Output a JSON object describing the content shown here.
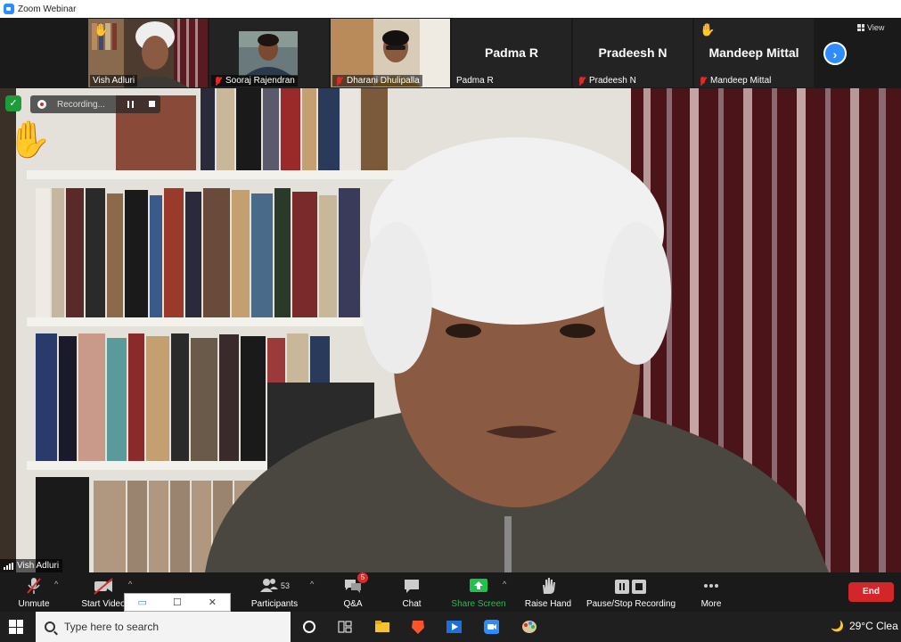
{
  "window": {
    "title": "Zoom Webinar"
  },
  "gallery": {
    "tiles": [
      {
        "name": "Vish Adluri"
      },
      {
        "name": "Sooraj Rajendran"
      },
      {
        "name": "Dharani Dhulipalla"
      },
      {
        "name": "Padma R",
        "display": "Padma R"
      },
      {
        "name": "Pradeesh N",
        "display": "Pradeesh N"
      },
      {
        "name": "Mandeep Mittal",
        "display": "Mandeep Mittal"
      }
    ],
    "view_label": "View"
  },
  "main_video": {
    "recording_label": "Recording...",
    "speaker_name": "Vish Adluri"
  },
  "toolbar": {
    "unmute": "Unmute",
    "start_video": "Start Video",
    "participants": "Participants",
    "participants_count": "53",
    "qa": "Q&A",
    "qa_badge": "5",
    "chat": "Chat",
    "share_screen": "Share Screen",
    "raise_hand": "Raise Hand",
    "pause_stop": "Pause/Stop Recording",
    "more": "More",
    "end": "End"
  },
  "taskbar": {
    "search_placeholder": "Type here to search",
    "weather": "29°C  Clea"
  },
  "colors": {
    "accent_blue": "#2d8cff",
    "end_red": "#d3262a",
    "share_green": "#1ec24d",
    "active_speaker": "#c8e84a"
  }
}
